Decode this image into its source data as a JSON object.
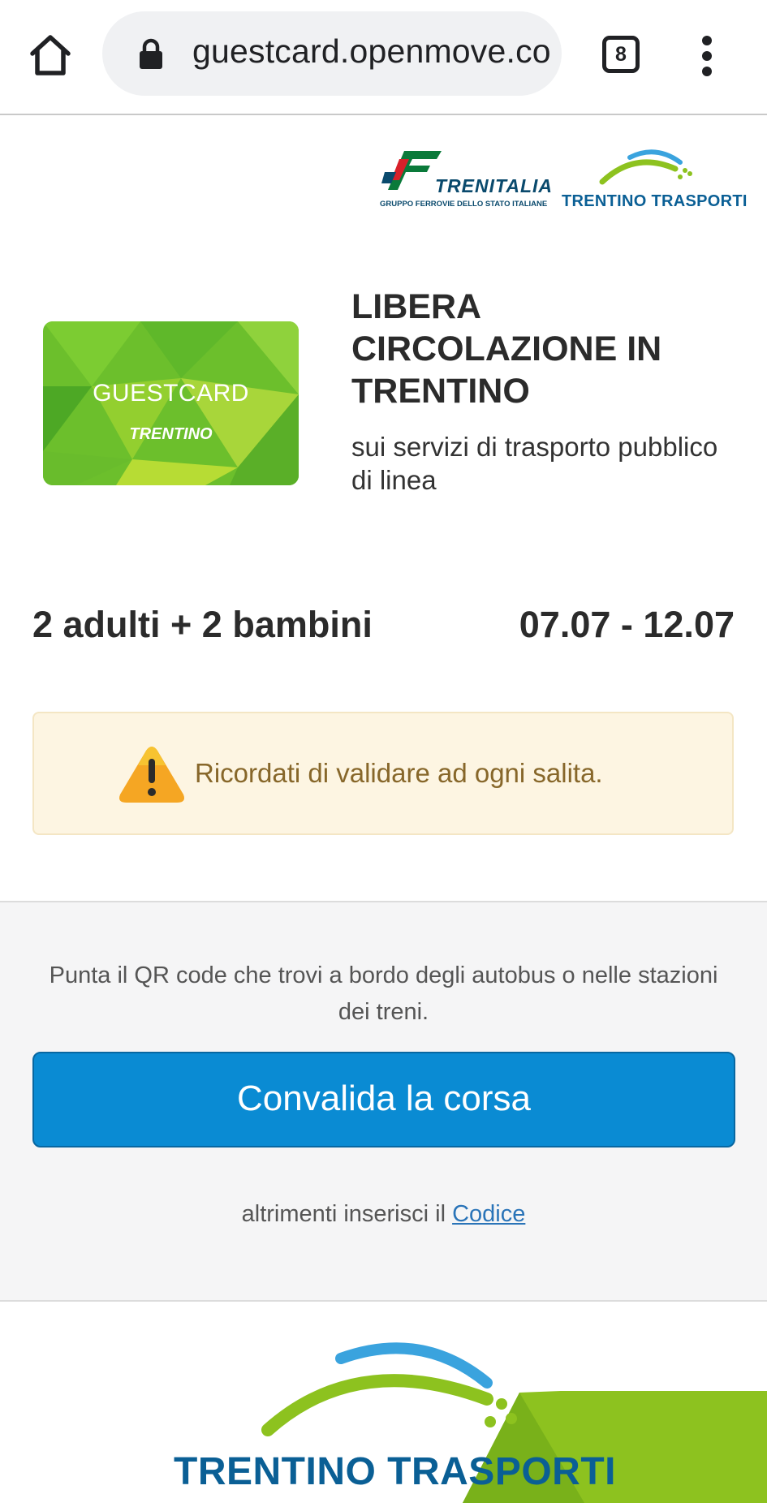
{
  "browser": {
    "url": "guestcard.openmove.co",
    "tab_count": "8"
  },
  "partners": {
    "trenitalia_name": "TRENITALIA",
    "trenitalia_tagline": "GRUPPO FERROVIE DELLO STATO ITALIANE",
    "trentino_trasporti_name": "TRENTINO TRASPORTI"
  },
  "card": {
    "title": "GUESTCARD",
    "brand": "TRENTINO"
  },
  "hero": {
    "title": "LIBERA CIRCOLAZIONE IN TRENTINO",
    "subtitle": "sui servizi di trasporto pubblico di linea"
  },
  "ticket": {
    "passengers": "2 adulti + 2 bambini",
    "dates": "07.07 - 12.07"
  },
  "alert": {
    "text": "Ricordati di validare ad ogni salita."
  },
  "validation": {
    "instruction": "Punta il QR code che trovi a bordo degli autobus o nelle stazioni dei treni.",
    "button_label": "Convalida la corsa",
    "alt_text": "altrimenti inserisci il",
    "alt_link": "Codice"
  },
  "footer": {
    "logo_text": "TRENTINO TRASPORTI"
  },
  "colors": {
    "cta": "#0a8bd3",
    "alert_bg": "#fdf5e2",
    "alert_text": "#87672a",
    "trentino_blue": "#0a5f95",
    "trentino_green": "#8dc21f"
  }
}
